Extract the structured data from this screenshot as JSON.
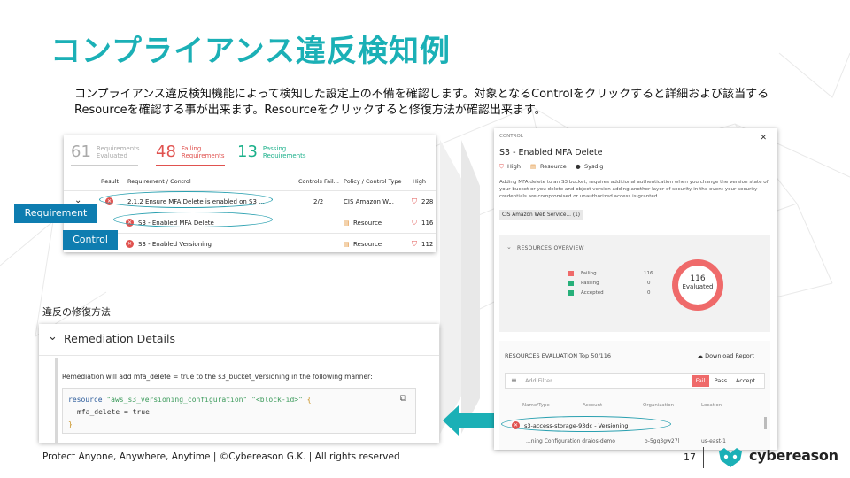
{
  "slide": {
    "title": "コンプライアンス違反検知例",
    "description": "コンプライアンス違反検知機能によって検知した設定上の不備を確認します。対象となるControlをクリックすると詳細および該当するResourceを確認する事が出来ます。Resourceをクリックすると修復方法が確認出来ます。",
    "remediation_label": "違反の修復方法",
    "footer": "Protect Anyone, Anywhere, Anytime | ©Cybereason G.K. | All rights reserved",
    "page_number": "17",
    "brand": "cybereason",
    "accent_color": "#1bb0b6",
    "tag_color": "#0e7db0"
  },
  "tags": {
    "requirement": "Requirement",
    "control": "Control"
  },
  "requirements": {
    "evaluated_num": "61",
    "evaluated_label_1": "Requirements",
    "evaluated_label_2": "Evaluated",
    "failing_num": "48",
    "failing_label_1": "Failing",
    "failing_label_2": "Requirements",
    "passing_num": "13",
    "passing_label_1": "Passing",
    "passing_label_2": "Requirements",
    "columns": {
      "result": "Result",
      "requirement": "Requirement / Control",
      "controls_failed": "Controls Fail...",
      "policy": "Policy / Control Type",
      "severity": "High"
    },
    "rows": [
      {
        "name": "2.1.2 Ensure MFA Delete is enabled on S3 ...",
        "controls": "2/2",
        "policy": "CIS Amazon W...",
        "count": "228"
      },
      {
        "name": "S3 - Enabled MFA Delete",
        "controls": "",
        "policy": "Resource",
        "count": "116"
      },
      {
        "name": "S3 - Enabled Versioning",
        "controls": "",
        "policy": "Resource",
        "count": "112"
      }
    ]
  },
  "remediation": {
    "title": "Remediation Details",
    "text": "Remediation will add mfa_delete = true to the s3_bucket_versioning in the following manner:",
    "code_1_kw": "resource",
    "code_1_str1": "\"aws_s3_versioning_configuration\"",
    "code_1_str2": "\"<block-id>\"",
    "code_1_brace": "{",
    "code_2": "mfa_delete = true",
    "code_3": "}"
  },
  "control_panel": {
    "section": "CONTROL",
    "title": "S3 - Enabled MFA Delete",
    "severity": "High",
    "type": "Resource",
    "source": "Sysdig",
    "description": "Adding MFA delete to an S3 bucket, requires additional authentication when you change the version state of your bucket or you delete and object version adding another layer of security in the event your security credentials are compromised or unauthorized access is granted.",
    "chip": "CIS Amazon Web Service... (1)",
    "overview_title": "RESOURCES OVERVIEW",
    "legend": [
      {
        "label": "Failing",
        "value": "116",
        "color": "#ef6a6a"
      },
      {
        "label": "Passing",
        "value": "0",
        "color": "#27b07a"
      },
      {
        "label": "Accepted",
        "value": "0",
        "color": "#27b07a"
      }
    ],
    "donut_value": "116",
    "donut_label": "Evaluated",
    "eval_title": "RESOURCES EVALUATION Top 50/116",
    "download": "Download Report",
    "filter_placeholder": "Add Filter...",
    "filter_fail": "Fail",
    "filter_pass": "Pass",
    "filter_accept": "Accept",
    "col_name": "Name/Type",
    "col_account": "Account",
    "col_org": "Organization",
    "col_location": "Location",
    "resource_name": "s3-access-storage-93dc - Versioning",
    "row2_name": "...ning Configuration draios-demo",
    "row2_org": "o-5gq3gw27l",
    "row2_loc": "us-east-1"
  }
}
